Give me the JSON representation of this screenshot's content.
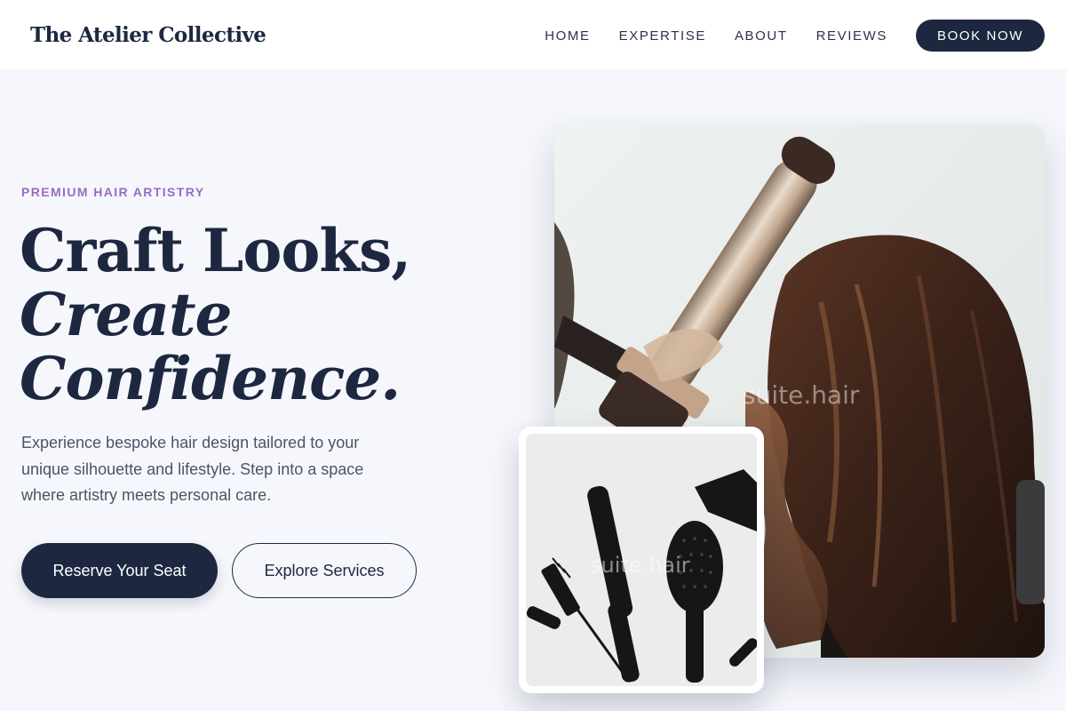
{
  "brand": {
    "name": "The Atelier Collective"
  },
  "nav": {
    "links": [
      "HOME",
      "EXPERTISE",
      "ABOUT",
      "REVIEWS"
    ],
    "cta": "BOOK NOW"
  },
  "hero": {
    "eyebrow": "PREMIUM HAIR ARTISTRY",
    "headline": {
      "line1": "Craft Looks,",
      "line2": "Create",
      "line3": "Confidence."
    },
    "lede": "Experience bespoke hair design tailored to your unique silhouette and lifestyle. Step into a space where artistry meets personal care.",
    "primary_button": "Reserve Your Seat",
    "secondary_button": "Explore Services"
  },
  "images": {
    "main_photo": {
      "watermark": "suite.hair",
      "subject": "curling-iron-styling-long-brown-hair"
    },
    "secondary_photo": {
      "watermark": "suite.hair",
      "subject": "black-hair-brushes-and-combs-flatlay"
    }
  },
  "colors": {
    "brand_navy": "#1d2840",
    "accent_purple": "#9a6bc4",
    "page_background": "#f6f7fc",
    "body_text": "#4b5466"
  }
}
